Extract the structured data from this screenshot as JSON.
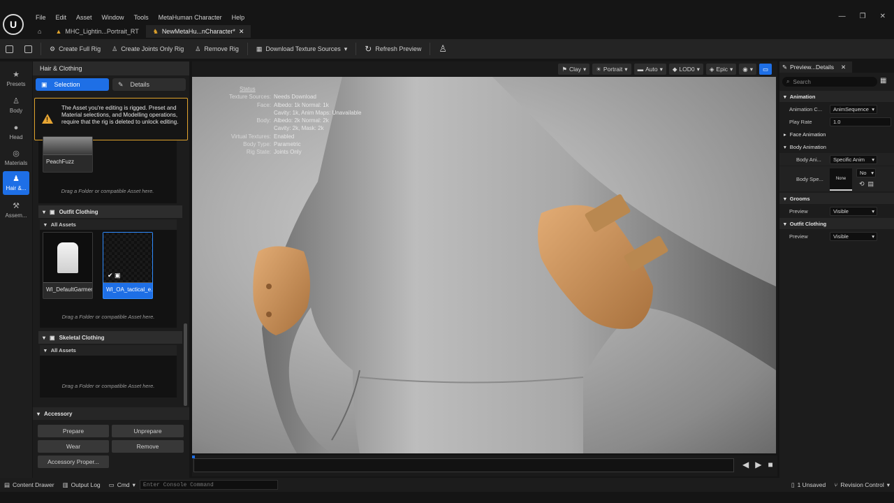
{
  "menu": [
    "File",
    "Edit",
    "Asset",
    "Window",
    "Tools",
    "MetaHuman Character",
    "Help"
  ],
  "tabs": [
    {
      "label": "MHC_Lightin...Portrait_RT"
    },
    {
      "label": "NewMetaHu...nCharacter*"
    }
  ],
  "toolbar": {
    "create_full_rig": "Create Full Rig",
    "create_joints_only_rig": "Create Joints Only Rig",
    "remove_rig": "Remove Rig",
    "download_texture_sources": "Download Texture Sources",
    "refresh_preview": "Refresh Preview"
  },
  "rail": [
    "Presets",
    "Body",
    "Head",
    "Materials",
    "Hair &...",
    "Assem..."
  ],
  "panel": {
    "title": "Hair & Clothing",
    "selection_tab": "Selection",
    "details_tab": "Details",
    "warning": "The Asset you're editing is rigged. Preset and Material selections, and Modelling operations, require that the rig is deleted to unlock editing.",
    "peachfuzz": "PeachFuzz",
    "drag_text": "Drag a Folder or compatible Asset here.",
    "outfit_section": "Outfit Clothing",
    "all_assets": "All Assets",
    "asset1": "WI_DefaultGarment",
    "asset2": "WI_OA_tactical_e...",
    "skeletal_section": "Skeletal Clothing",
    "accessory_section": "Accessory",
    "prepare": "Prepare",
    "unprepare": "Unprepare",
    "wear": "Wear",
    "remove": "Remove",
    "accessory_props": "Accessory Proper..."
  },
  "viewport": {
    "buttons": [
      "Clay",
      "Portrait",
      "Auto",
      "LOD0",
      "Epic"
    ],
    "stats": [
      {
        "k": "Status",
        "v": ""
      },
      {
        "k": "Texture Sources:",
        "v": "Needs Download"
      },
      {
        "k": "Face:",
        "v": "Albedo: 1k Normal: 1k"
      },
      {
        "k": "",
        "v": "Cavity: 1k, Anim Maps: Unavailable"
      },
      {
        "k": "Body:",
        "v": "Albedo: 2k Normal: 2k"
      },
      {
        "k": "",
        "v": "Cavity: 2k, Mask: 2k"
      },
      {
        "k": "Virtual Textures:",
        "v": "Enabled"
      },
      {
        "k": "Body Type:",
        "v": "Parametric"
      },
      {
        "k": "Rig State:",
        "v": "Joints Only"
      }
    ]
  },
  "details": {
    "tab": "Preview...Details",
    "search_placeholder": "Search",
    "animation": "Animation",
    "animation_class": "Animation C...",
    "animation_class_value": "AnimSequence",
    "play_rate": "Play Rate",
    "play_rate_value": "1.0",
    "face_animation": "Face Animation",
    "body_animation": "Body Animation",
    "body_anim": "Body Ani...",
    "body_anim_value": "Specific Anim",
    "body_spec": "Body Spe...",
    "none": "None",
    "no": "No",
    "grooms": "Grooms",
    "preview": "Preview",
    "visible": "Visible",
    "outfit_clothing": "Outfit Clothing"
  },
  "status": {
    "content_drawer": "Content Drawer",
    "output_log": "Output Log",
    "cmd": "Cmd",
    "console_placeholder": "Enter Console Command",
    "unsaved": "1 Unsaved",
    "revision_control": "Revision Control"
  },
  "colors": {
    "accent": "#1e6fe6",
    "warning": "#e0a32c",
    "pads": "#c98d55"
  }
}
